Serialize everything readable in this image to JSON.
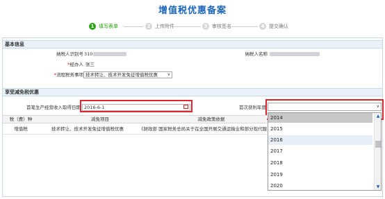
{
  "title": "增值税优惠备案",
  "steps": [
    {
      "num": "1",
      "label": "填写表单",
      "active": true
    },
    {
      "num": "2",
      "label": "上传附件",
      "active": false
    },
    {
      "num": "3",
      "label": "审核签名",
      "active": false
    },
    {
      "num": "4",
      "label": "提交确认",
      "active": false
    }
  ],
  "basic": {
    "section_title": "基本信息",
    "taxpayer_id_label": "纳税人识别号",
    "taxpayer_id_value": "310",
    "taxpayer_name_label": "纳税人名称",
    "handler_label": "经办人",
    "handler_value": "张三",
    "process_label": "流程税务事项",
    "process_value": "技术转让、技术开发免征增值税优惠"
  },
  "relief": {
    "section_title": "享受减免税优惠",
    "first_income_label": "首笔生产经营收入取得日期",
    "first_income_value": "2016-6-1",
    "first_profit_year_label": "首次获利年度",
    "first_profit_year_value": ""
  },
  "table": {
    "headers": [
      "税（费）种",
      "减免项目",
      "减免政策依据"
    ],
    "rows": [
      [
        "增值税",
        "技术转让、技术开发免征增值税优惠",
        "《财政部 国家税务总局关于在全国开展交通运输业和部分现代服"
      ]
    ]
  },
  "year_dropdown": {
    "options": [
      "2014",
      "2015",
      "2016",
      "2017",
      "2018",
      "2019",
      "2020"
    ],
    "highlighted": "2014",
    "hovered": "2016"
  }
}
